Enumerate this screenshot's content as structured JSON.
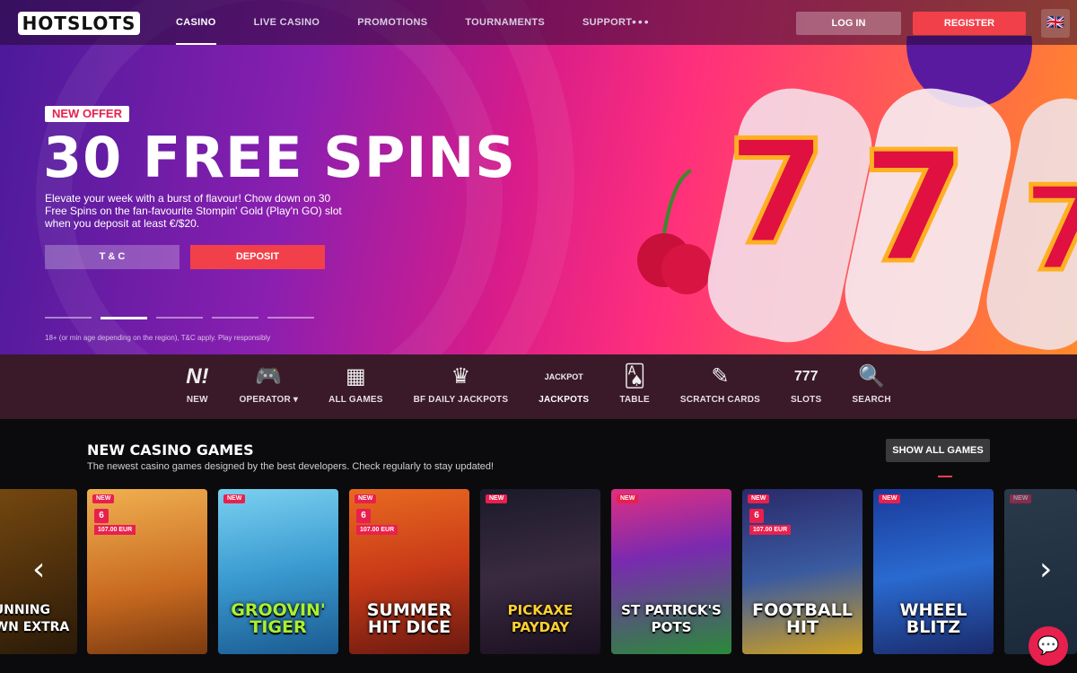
{
  "header": {
    "logo": "HOTSLOTS",
    "nav": [
      "CASINO",
      "LIVE CASINO",
      "PROMOTIONS",
      "TOURNAMENTS",
      "SUPPORT"
    ],
    "more": "•••",
    "login": "LOG IN",
    "register": "REGISTER",
    "lang": "🇬🇧"
  },
  "hero": {
    "badge": "NEW OFFER",
    "title": "30 FREE SPINS",
    "description": "Elevate your week with a burst of flavour! Chow down on 30 Free Spins on the fan-favourite Stompin' Gold (Play'n GO) slot when you deposit at least €/$20.",
    "tc": "T & C",
    "deposit": "DEPOSIT",
    "disclaimer": "18+ (or min age depending on the region), T&C apply. Play responsibly"
  },
  "categories": [
    {
      "icon": "N!",
      "label": "NEW"
    },
    {
      "icon": "🎮",
      "label": "OPERATOR ▾"
    },
    {
      "icon": "▦",
      "label": "ALL GAMES"
    },
    {
      "icon": "♛",
      "label": "BF DAILY JACKPOTS"
    },
    {
      "icon": "JACKPOT",
      "label": "JACKPOTS"
    },
    {
      "icon": "🂡",
      "label": "TABLE"
    },
    {
      "icon": "✎",
      "label": "SCRATCH CARDS"
    },
    {
      "icon": "777",
      "label": "SLOTS"
    },
    {
      "icon": "🔍",
      "label": "SEARCH"
    }
  ],
  "section": {
    "title": "NEW CASINO GAMES",
    "subtitle": "The newest casino games designed by the best developers. Check regularly to stay updated!",
    "show_all": "SHOW ALL GAMES"
  },
  "games": [
    {
      "name": "RUNNING CROWN EXTRA",
      "tag": "",
      "num": "",
      "amount": ""
    },
    {
      "name": "",
      "tag": "NEW",
      "num": "6",
      "amount": "107.00 EUR"
    },
    {
      "name": "GROOVIN' TIGER",
      "tag": "NEW",
      "num": "",
      "amount": ""
    },
    {
      "name": "SUMMER HIT DICE",
      "tag": "NEW",
      "num": "6",
      "amount": "107.00 EUR"
    },
    {
      "name": "PICKAXE PAYDAY",
      "tag": "NEW",
      "num": "",
      "amount": ""
    },
    {
      "name": "ST PATRICK'S POTS",
      "tag": "NEW",
      "num": "",
      "amount": ""
    },
    {
      "name": "FOOTBALL HIT",
      "tag": "NEW",
      "num": "6",
      "amount": "107.00 EUR"
    },
    {
      "name": "WHEEL BLITZ",
      "tag": "NEW",
      "num": "",
      "amount": ""
    },
    {
      "name": "",
      "tag": "NEW",
      "num": "",
      "amount": ""
    }
  ],
  "chat_icon": "💬"
}
